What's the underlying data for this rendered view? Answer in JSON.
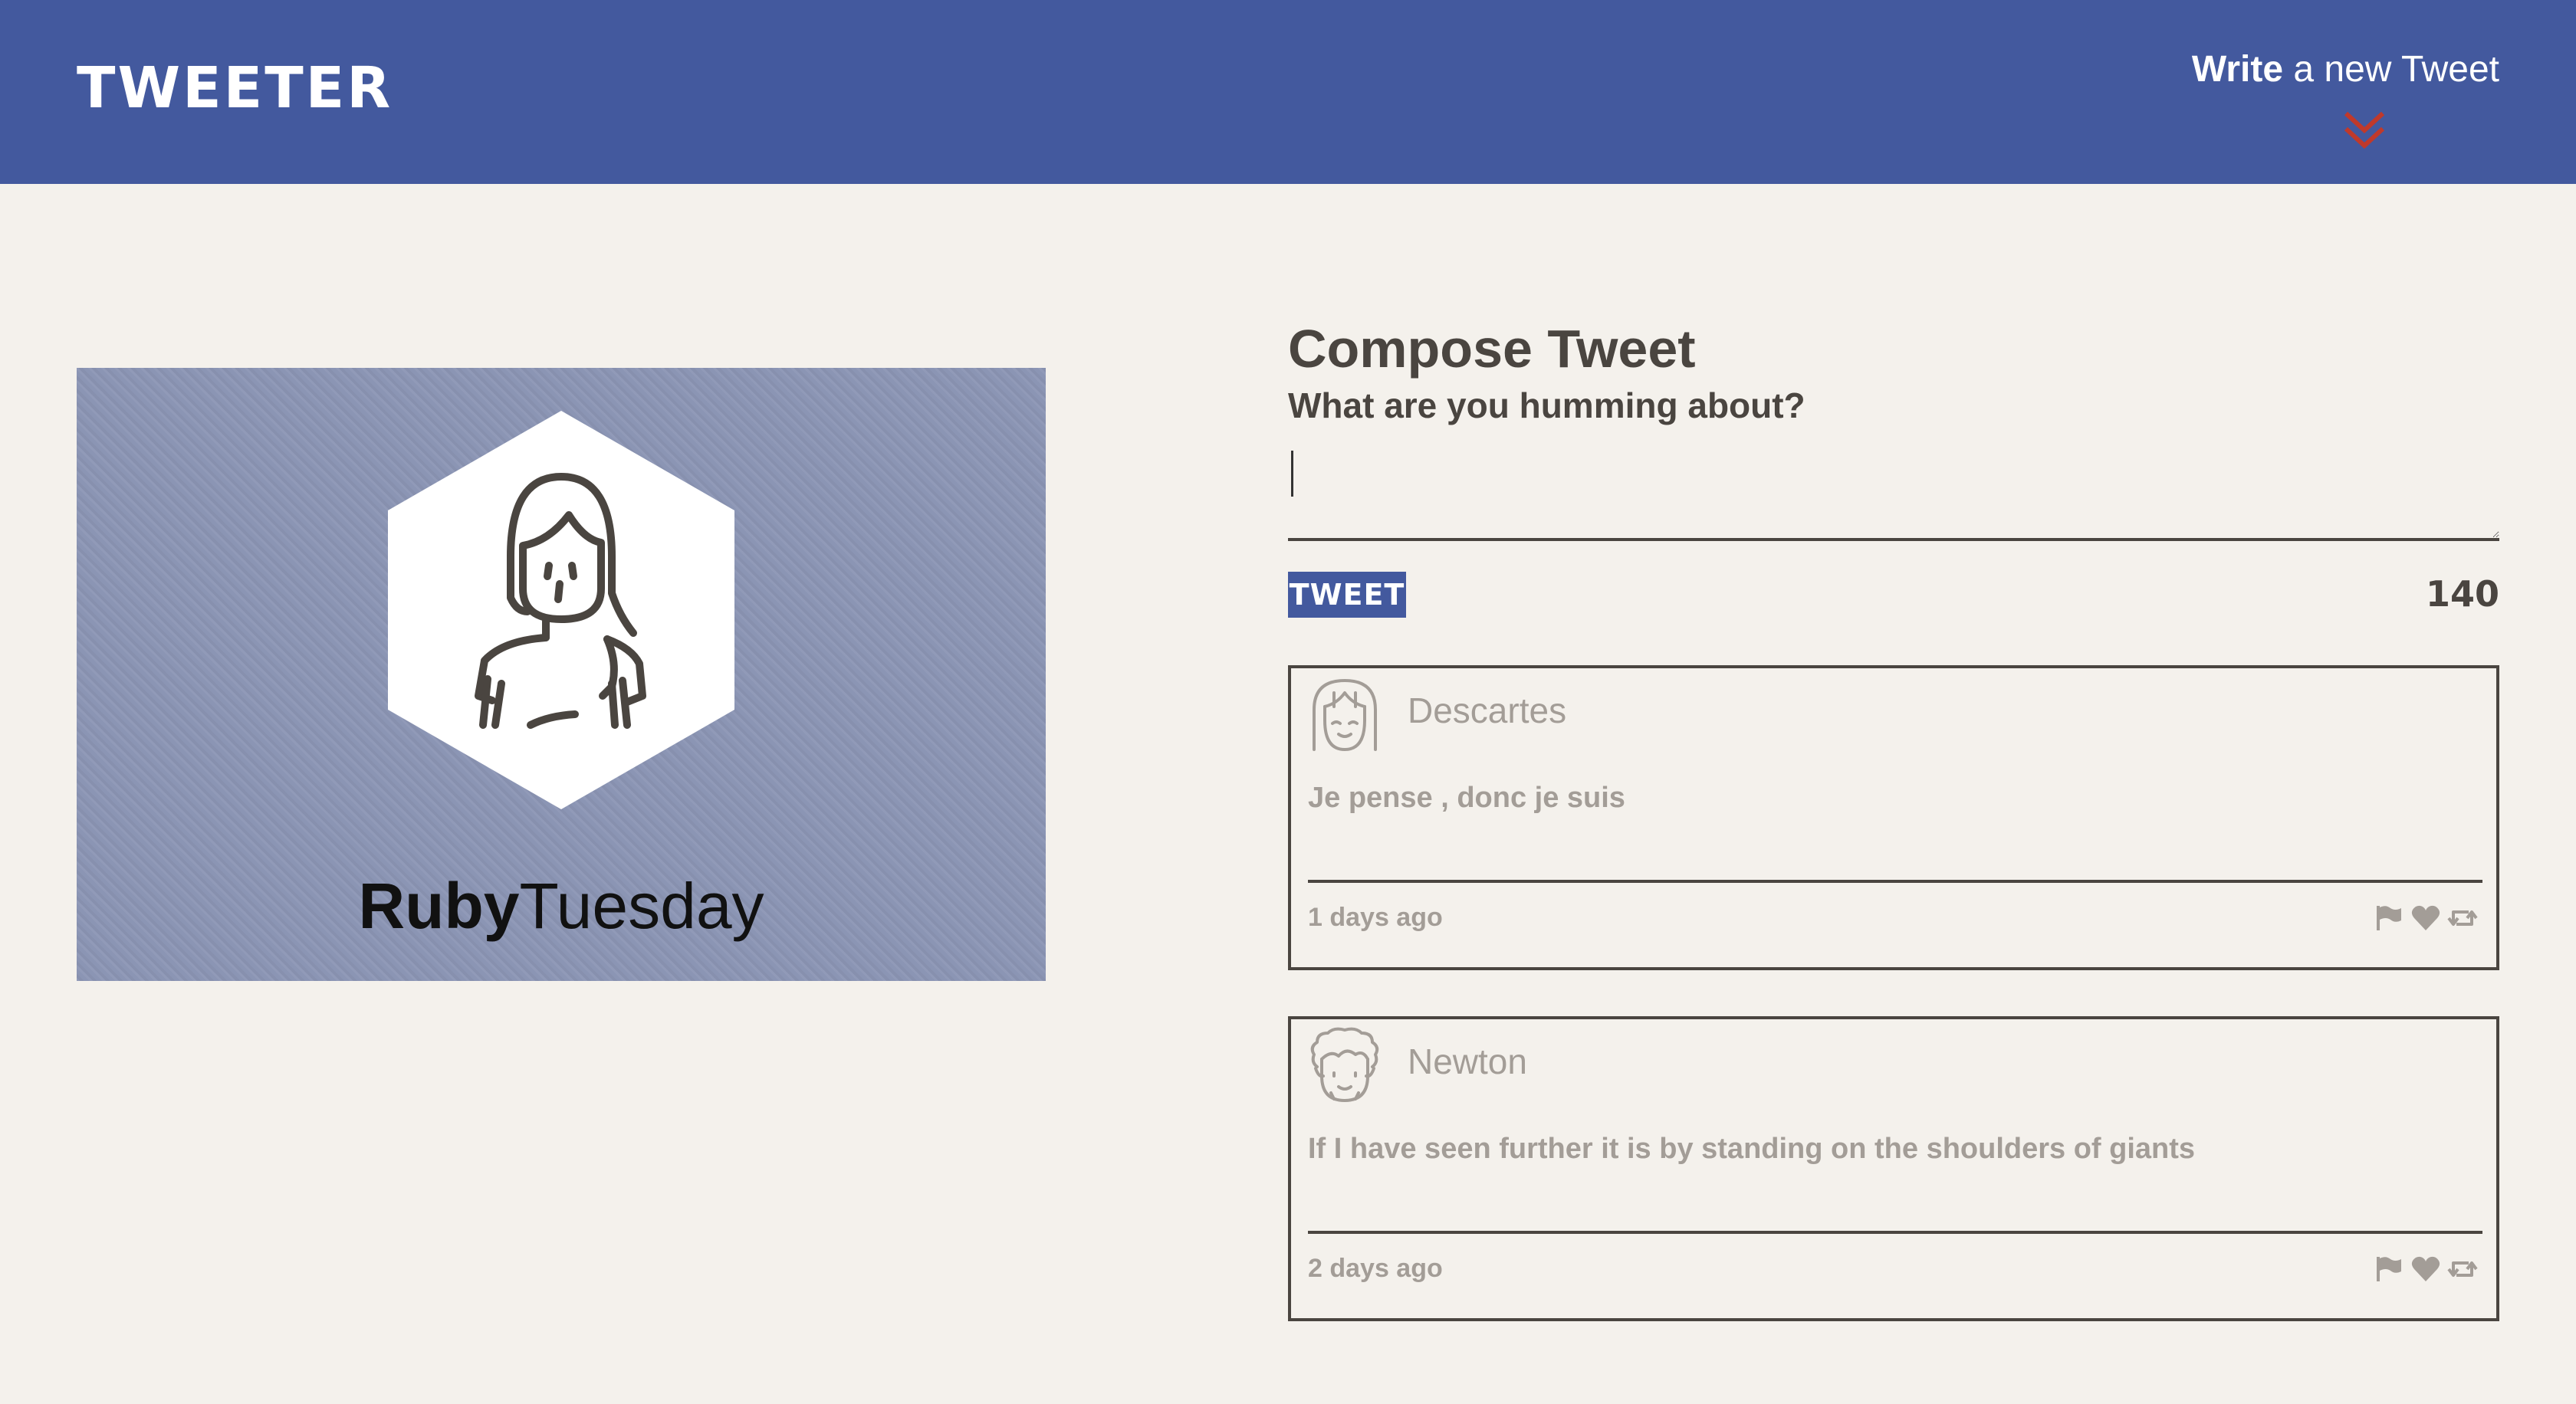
{
  "header": {
    "brand": "TWEETER",
    "toggle_strong": "Write",
    "toggle_rest": " a new Tweet",
    "toggle_icon": "double-chevron-down-icon"
  },
  "profile": {
    "first_name": "Ruby",
    "last_name": "Tuesday",
    "avatar_icon": "woman-avatar-icon"
  },
  "compose": {
    "title": "Compose Tweet",
    "label": "What are you humming about?",
    "input_value": "",
    "submit_label": "TWEET",
    "char_count": "140"
  },
  "tweets": [
    {
      "author": "Descartes",
      "avatar_icon": "girl-avatar-icon",
      "text": "Je pense , donc je suis",
      "time": "1 days ago",
      "actions": [
        "flag-icon",
        "heart-icon",
        "retweet-icon"
      ]
    },
    {
      "author": "Newton",
      "avatar_icon": "curly-hair-avatar-icon",
      "text": "If I have seen further it is by standing on the shoulders of giants",
      "time": "2 days ago",
      "actions": [
        "flag-icon",
        "heart-icon",
        "retweet-icon"
      ]
    }
  ],
  "colors": {
    "nav": "#43599e",
    "background": "#f4f1ec",
    "text_dark": "#4a4540",
    "text_muted": "#a39d97",
    "accent_red": "#c0392b",
    "profile_bg": "#8b95b4"
  }
}
